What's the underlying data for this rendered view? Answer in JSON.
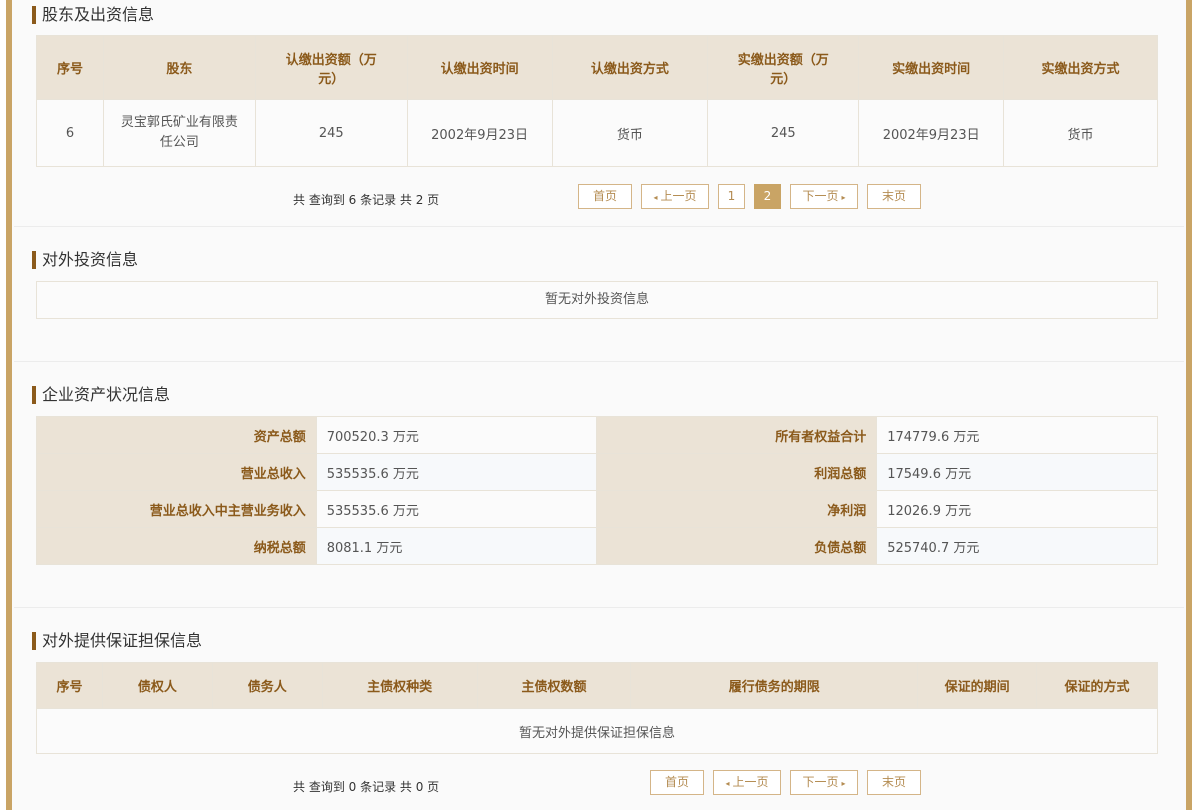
{
  "shareholders": {
    "title": "股东及出资信息",
    "headers": [
      "序号",
      "股东",
      "认缴出资额（万元）",
      "认缴出资时间",
      "认缴出资方式",
      "实缴出资额（万元）",
      "实缴出资时间",
      "实缴出资方式"
    ],
    "rows": [
      [
        "6",
        "灵宝郭氏矿业有限责任公司",
        "245",
        "2002年9月23日",
        "货币",
        "245",
        "2002年9月23日",
        "货币"
      ]
    ],
    "pager": {
      "info": "共 查询到 6 条记录 共 2 页",
      "first": "首页",
      "prev": "上一页",
      "pages": [
        "1",
        "2"
      ],
      "current": "2",
      "next": "下一页",
      "last": "末页"
    }
  },
  "investments": {
    "title": "对外投资信息",
    "empty": "暂无对外投资信息"
  },
  "assets": {
    "title": "企业资产状况信息",
    "rows": [
      {
        "l_label": "资产总额",
        "l_value": "700520.3 万元",
        "r_label": "所有者权益合计",
        "r_value": "174779.6 万元"
      },
      {
        "l_label": "营业总收入",
        "l_value": "535535.6 万元",
        "r_label": "利润总额",
        "r_value": "17549.6 万元"
      },
      {
        "l_label": "营业总收入中主营业务收入",
        "l_value": "535535.6 万元",
        "r_label": "净利润",
        "r_value": "12026.9 万元"
      },
      {
        "l_label": "纳税总额",
        "l_value": "8081.1 万元",
        "r_label": "负债总额",
        "r_value": "525740.7 万元"
      }
    ]
  },
  "guarantees": {
    "title": "对外提供保证担保信息",
    "headers": [
      "序号",
      "债权人",
      "债务人",
      "主债权种类",
      "主债权数额",
      "履行债务的期限",
      "保证的期间",
      "保证的方式"
    ],
    "empty": "暂无对外提供保证担保信息",
    "pager": {
      "info": "共 查询到 0 条记录 共 0 页",
      "first": "首页",
      "prev": "上一页",
      "next": "下一页",
      "last": "末页"
    }
  },
  "colors": {
    "accent": "#c9a465",
    "header_bg": "#ebe3d6",
    "header_text": "#8b5a1b",
    "title_bar": "#8b5a1b"
  }
}
